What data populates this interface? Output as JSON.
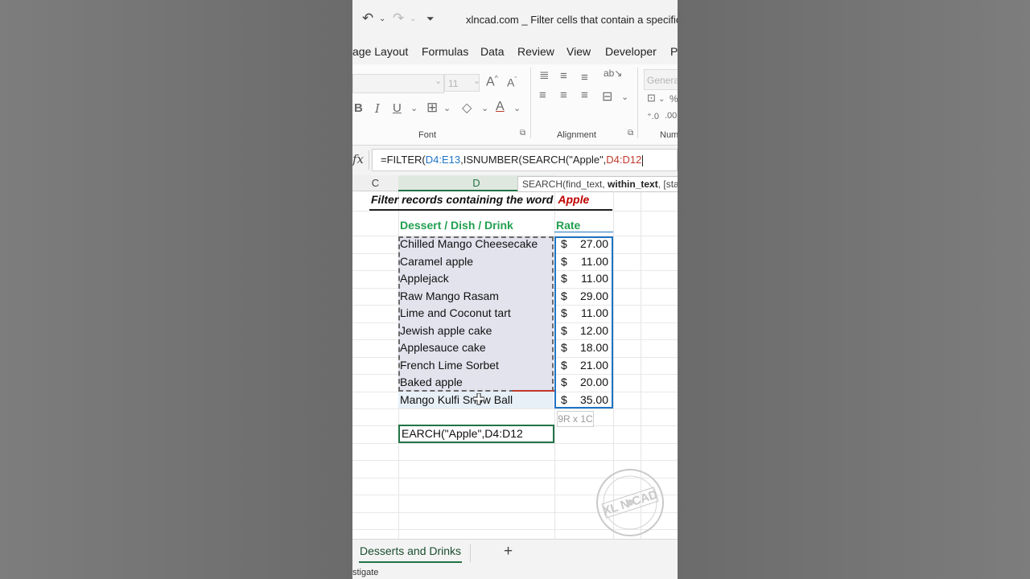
{
  "window": {
    "title": "xlncad.com _ Filter cells that contain a specific text",
    "icons": [
      "undo-icon",
      "redo-icon",
      "customize-quick-access-icon"
    ]
  },
  "ribbon_tabs": [
    "age Layout",
    "Formulas",
    "Data",
    "Review",
    "View",
    "Developer",
    "Pc"
  ],
  "ribbon": {
    "font_size_placeholder": "11",
    "number_format_placeholder": "Genera",
    "font_group_label": "Font",
    "alignment_group_label": "Alignment",
    "number_group_label": "Num",
    "bold_label": "B",
    "italic_label": "I",
    "underline_label": "U"
  },
  "formula_bar": {
    "fx_label": "fx",
    "parts": {
      "p1": "=FILTER(",
      "p2": "D4:E13",
      "p3": ",ISNUMBER(",
      "p4": "SEARCH(",
      "p5": "\"Apple\",",
      "p6": "D4:D12"
    }
  },
  "tooltip": {
    "func": "SEARCH(find_text, ",
    "bold_arg": "within_text",
    "rest": ", [start"
  },
  "columns": [
    "C",
    "D"
  ],
  "sheet": {
    "heading": "Filter records containing the word",
    "heading_word": "Apple",
    "col_header_item": "Dessert / Dish / Drink",
    "col_header_rate": "Rate",
    "currency": "$",
    "rows": [
      {
        "item": "Chilled Mango Cheesecake",
        "rate": "27.00"
      },
      {
        "item": "Caramel apple",
        "rate": "11.00"
      },
      {
        "item": "Applejack",
        "rate": "11.00"
      },
      {
        "item": "Raw Mango Rasam",
        "rate": "29.00"
      },
      {
        "item": "Lime and Coconut tart",
        "rate": "11.00"
      },
      {
        "item": "Jewish apple cake",
        "rate": "12.00"
      },
      {
        "item": "Applesauce cake",
        "rate": "18.00"
      },
      {
        "item": "French Lime Sorbet",
        "rate": "21.00"
      },
      {
        "item": "Baked apple",
        "rate": "20.00"
      },
      {
        "item": "Mango Kulfi Snow Ball",
        "rate": "35.00"
      }
    ],
    "selection_size": "9R x 1C",
    "edit_cell_text": "EARCH(\"Apple\",D4:D12"
  },
  "watermark": {
    "text": "XL N CAD"
  },
  "sheet_tabs": [
    {
      "label": "Desserts and Drinks",
      "active": true
    }
  ],
  "status": {
    "text": "stigate"
  },
  "colors": {
    "excel_green": "#217346",
    "header_green": "#22a050",
    "ref_blue": "#1f74c4",
    "ref_red": "#c0392b",
    "highlight_red": "#c00000"
  }
}
